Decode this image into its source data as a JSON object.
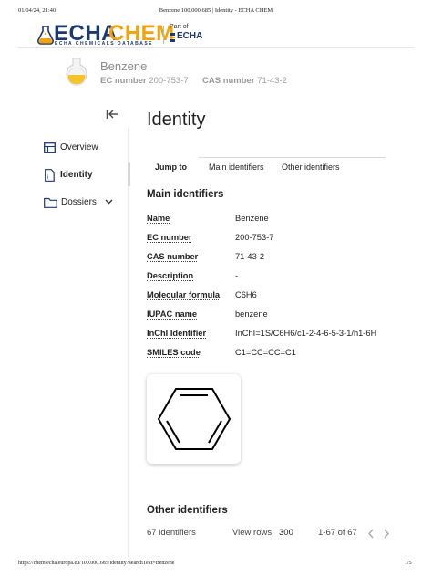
{
  "print_header": {
    "datetime": "01/04/24, 21:40",
    "doc_title": "Benzene 100.000.685 | Identity - ECHA CHEM"
  },
  "print_footer": {
    "url": "https://chem.echa.europa.eu/100.000.685/identity?searchText=Benzene",
    "page": "1/5"
  },
  "logo": {
    "word_dark": "ECHA",
    "word_accent": "CHEM",
    "tagline": "ECHA CHEMICALS DATABASE",
    "partof_label": "Part of",
    "partof_name": "ECHA",
    "colors": {
      "navy": "#1d3a6e",
      "orange": "#f2a20c"
    }
  },
  "substance": {
    "name": "Benzene",
    "ec_label": "EC number",
    "ec_value": "200-753-7",
    "cas_label": "CAS number",
    "cas_value": "71-43-2"
  },
  "sidebar": {
    "collapse_icon": "collapse-left-icon",
    "items": [
      {
        "label": "Overview",
        "icon": "overview-icon"
      },
      {
        "label": "Identity",
        "icon": "identity-icon"
      },
      {
        "label": "Dossiers",
        "icon": "folder-icon"
      }
    ]
  },
  "main": {
    "title": "Identity",
    "tabs": {
      "jump_to": "Jump to",
      "main": "Main identifiers",
      "other": "Other identifiers"
    },
    "main_identifiers_heading": "Main identifiers",
    "rows": [
      {
        "label": "Name",
        "value": "Benzene"
      },
      {
        "label": "EC number",
        "value": "200-753-7"
      },
      {
        "label": "CAS number",
        "value": "71-43-2"
      },
      {
        "label": "Description",
        "value": "-"
      },
      {
        "label": "Molecular formula",
        "value": "C6H6"
      },
      {
        "label": "IUPAC name",
        "value": "benzene"
      },
      {
        "label": "InChI Identifier",
        "value": "InChI=1S/C6H6/c1-2-4-6-5-3-1/h1-6H"
      },
      {
        "label": "SMILES code",
        "value": "C1=CC=CC=C1"
      }
    ],
    "other_identifiers_heading": "Other identifiers",
    "footer": {
      "count": "67 identifiers",
      "view_rows_label": "View rows",
      "view_rows_value": "300",
      "range": "1-67 of 67"
    }
  }
}
